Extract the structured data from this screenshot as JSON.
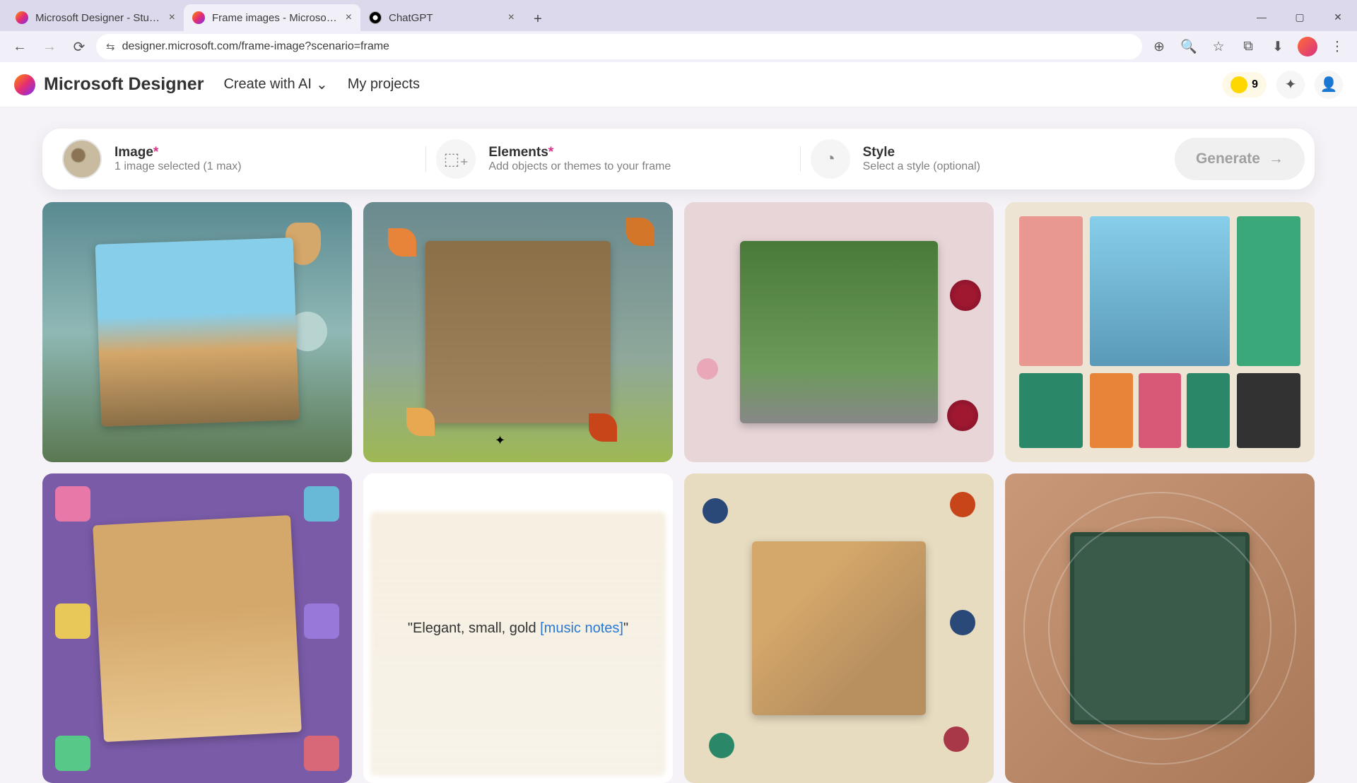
{
  "browser": {
    "tabs": [
      {
        "title": "Microsoft Designer - Stunning",
        "active": false
      },
      {
        "title": "Frame images - Microsoft Desi",
        "active": true
      },
      {
        "title": "ChatGPT",
        "active": false
      }
    ],
    "url": "designer.microsoft.com/frame-image?scenario=frame"
  },
  "header": {
    "brand": "Microsoft Designer",
    "create_label": "Create with AI",
    "projects_label": "My projects",
    "credits": "9"
  },
  "stages": {
    "image": {
      "label": "Image",
      "sub": "1 image selected (1 max)"
    },
    "elements": {
      "label": "Elements",
      "sub": "Add objects or themes to your frame"
    },
    "style": {
      "label": "Style",
      "sub": "Select a style (optional)"
    },
    "generate_label": "Generate"
  },
  "hover_prompt": {
    "prefix": "\"Elegant, small, gold ",
    "link": "[music notes]",
    "suffix": "\""
  }
}
